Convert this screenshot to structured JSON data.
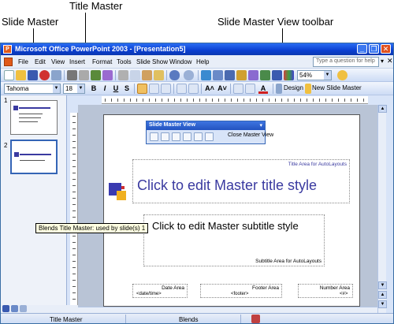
{
  "callouts": {
    "title_master": "Title Master",
    "slide_master": "Slide Master",
    "slide_master_view_toolbar": "Slide Master View toolbar"
  },
  "window": {
    "title": "Microsoft Office PowerPoint 2003 - [Presentation5]",
    "minimize": "_",
    "restore": "❐",
    "close": "✕"
  },
  "menu": {
    "items": [
      "File",
      "Edit",
      "View",
      "Insert",
      "Format",
      "Tools",
      "Slide Show",
      "Window",
      "Help"
    ],
    "help_placeholder": "Type a question for help",
    "help_arrow": "▾",
    "doc_close": "✕"
  },
  "toolbar": {
    "zoom": "54%",
    "font": "Tahoma",
    "size": "18",
    "bold": "B",
    "italic": "I",
    "underline": "U",
    "shadow": "S",
    "grow_font": "A˄",
    "shrink_font": "A˅",
    "font_color": "A",
    "design_label": "Design",
    "new_slide_master_label": "New Slide Master"
  },
  "thumbnails": [
    {
      "number": "1"
    },
    {
      "number": "2"
    }
  ],
  "tooltip": "Blends Title Master: used by slide(s) 1",
  "slide_master_toolbar": {
    "title": "Slide Master View",
    "menu_arrow": "▾",
    "close_label": "Close Master View"
  },
  "slide": {
    "title_area_label": "Title Area for AutoLayouts",
    "title_text": "Click to edit Master title style",
    "subtitle_text": "Click to edit Master subtitle style",
    "subtitle_area_label": "Subtitle Area for AutoLayouts",
    "date_area_label": "Date Area",
    "date_value": "<date/time>",
    "footer_area_label": "Footer Area",
    "footer_value": "<footer>",
    "number_area_label": "Number Area",
    "number_value": "<#>"
  },
  "status": {
    "master_name": "Title Master",
    "design_name": "Blends"
  },
  "colors": {
    "title_bar": "#0a3fd1",
    "title_text": "#3a3aa0",
    "canvas_bg": "#b9c4d6"
  }
}
